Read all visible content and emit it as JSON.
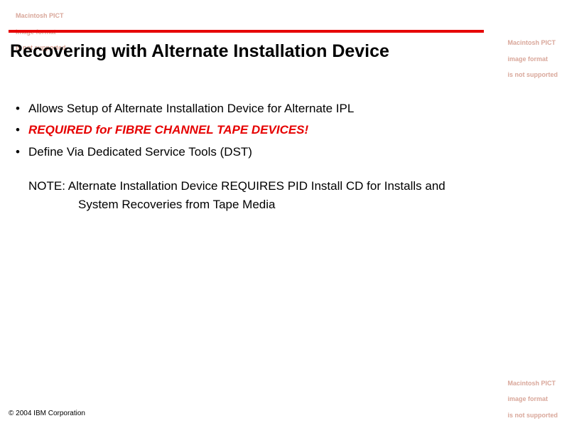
{
  "pict_error": {
    "line1": "Macintosh PICT",
    "line2": "image format",
    "line3": "is not supported"
  },
  "title": "Recovering with Alternate Installation Device",
  "bullets": [
    {
      "text": "Allows Setup of Alternate Installation Device for Alternate IPL",
      "style": "normal"
    },
    {
      "text": "REQUIRED for FIBRE CHANNEL TAPE DEVICES!",
      "style": "required"
    },
    {
      "text": "Define Via Dedicated Service Tools (DST)",
      "style": "normal"
    }
  ],
  "note": {
    "line1": "NOTE: Alternate Installation Device REQUIRES PID Install CD for Installs and",
    "line2": "System Recoveries from Tape Media"
  },
  "footer": "© 2004 IBM Corporation"
}
